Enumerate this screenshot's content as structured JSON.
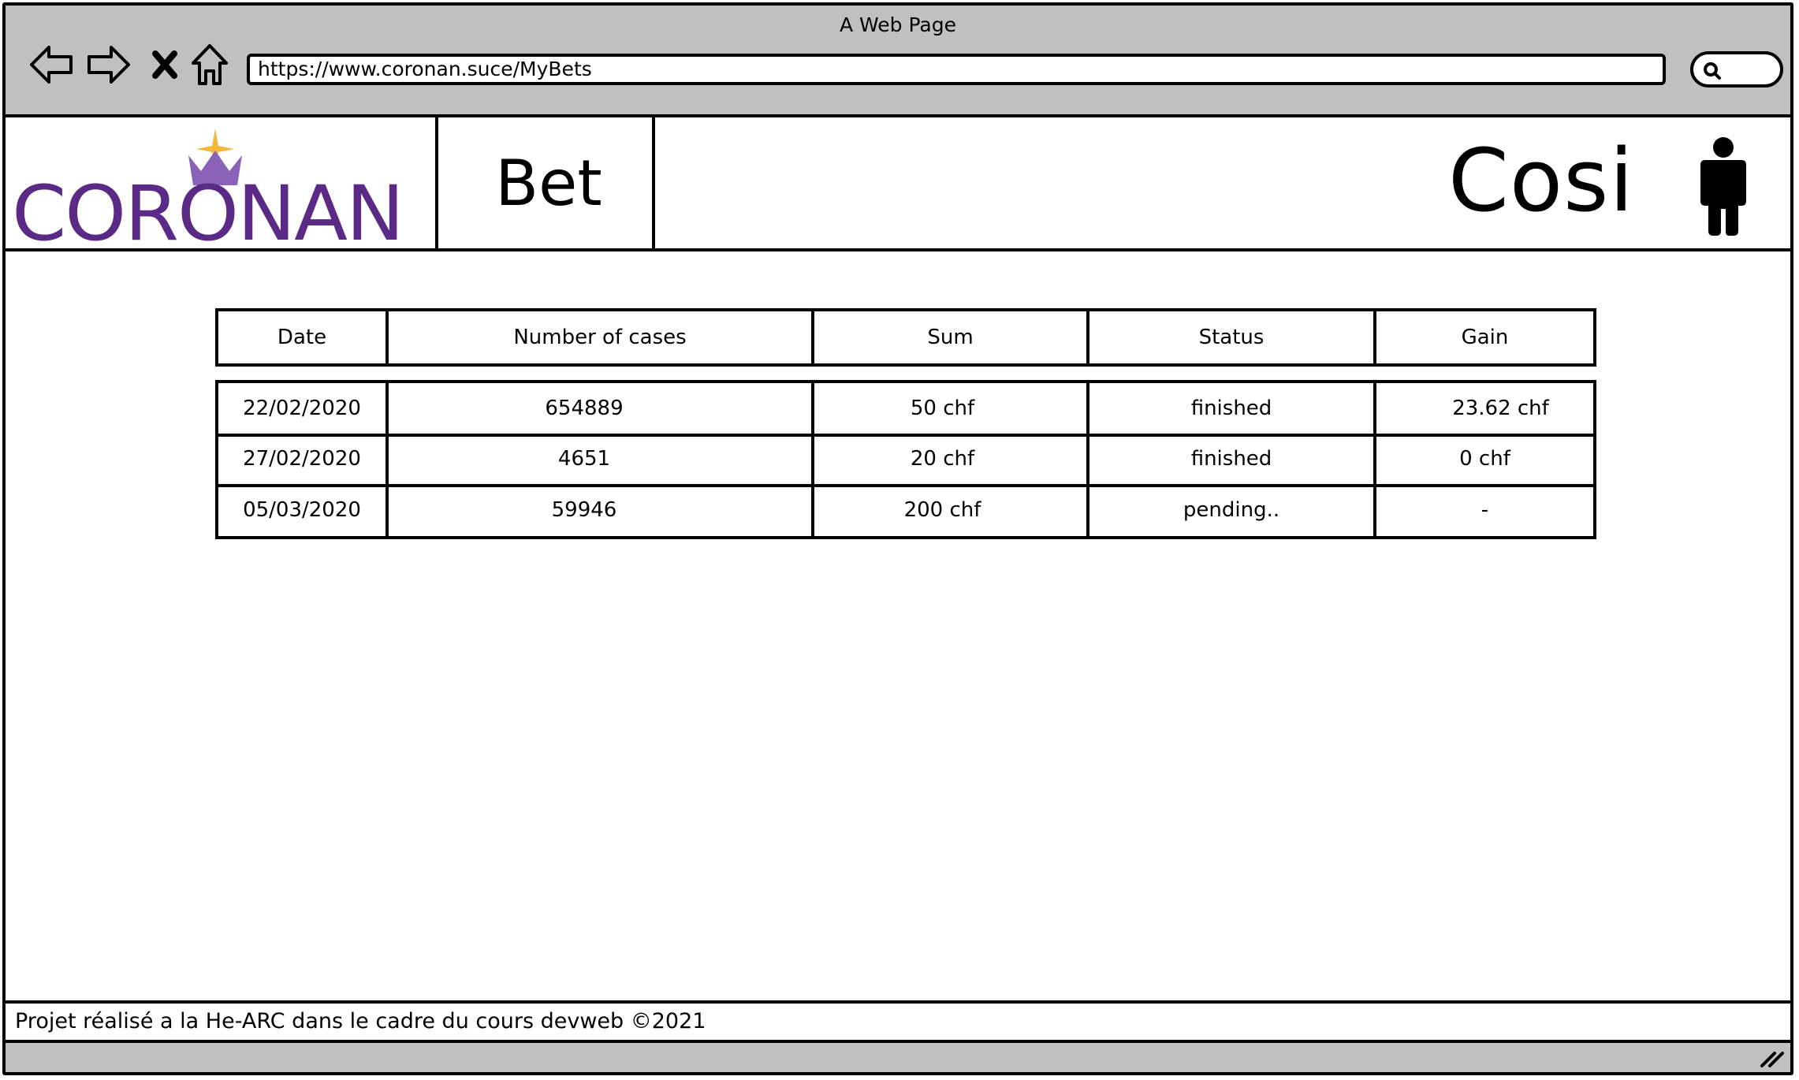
{
  "window": {
    "title": "A Web Page"
  },
  "browser": {
    "url": "https://www.coronan.suce/MyBets",
    "icons": [
      "back-arrow-icon",
      "forward-arrow-icon",
      "close-x-icon",
      "home-icon",
      "search-icon"
    ]
  },
  "header": {
    "logo_text": "CORONAN",
    "nav_label": "Bet",
    "username": "Cosi",
    "brand_color": "#5b2a86",
    "accent_color": "#f4b73a"
  },
  "table": {
    "columns": [
      "Date",
      "Number of cases",
      "Sum",
      "Status",
      "Gain"
    ],
    "rows": [
      [
        "22/02/2020",
        "654889",
        "50 chf",
        "finished",
        "23.62 chf"
      ],
      [
        "27/02/2020",
        "4651",
        "20 chf",
        "finished",
        "0 chf"
      ],
      [
        "05/03/2020",
        "59946",
        "200 chf",
        "pending..",
        "-"
      ]
    ]
  },
  "footer": {
    "text": "Projet réalisé a la He-ARC dans le cadre du cours devweb ©2021"
  }
}
